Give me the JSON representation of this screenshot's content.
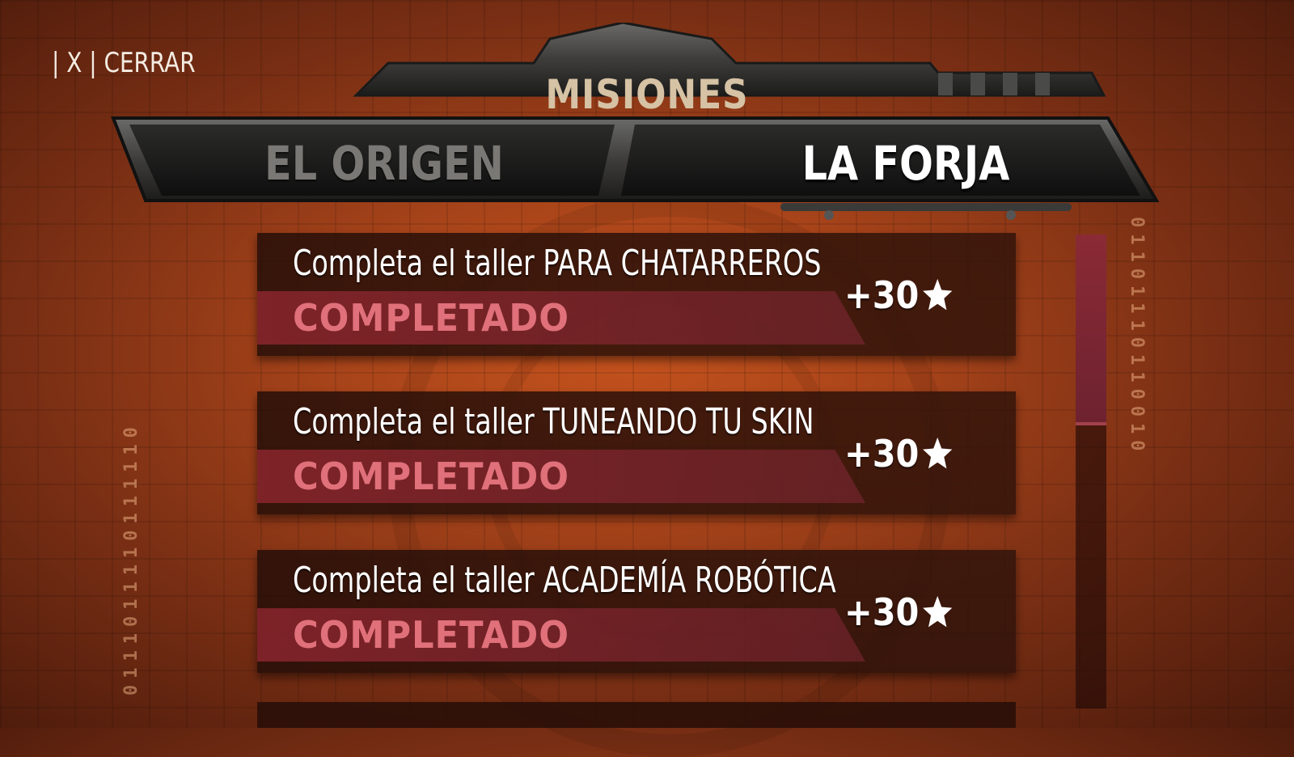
{
  "close_button": {
    "label": "| X | CERRAR"
  },
  "header": {
    "title": "MISIONES"
  },
  "tabs": [
    {
      "label": "EL ORIGEN",
      "active": false
    },
    {
      "label": "LA FORJA",
      "active": true
    }
  ],
  "missions": [
    {
      "title": "Completa el taller PARA CHATARREROS",
      "status": "COMPLETADO",
      "reward": "+30",
      "reward_icon": "star-icon"
    },
    {
      "title": "Completa el taller TUNEANDO TU SKIN",
      "status": "COMPLETADO",
      "reward": "+30",
      "reward_icon": "star-icon"
    },
    {
      "title": "Completa el taller ACADEMÍA ROBÓTICA",
      "status": "COMPLETADO",
      "reward": "+30",
      "reward_icon": "star-icon"
    }
  ],
  "scrollbar": {
    "position": 0.0
  },
  "background": {
    "binary_left": "0111011110111110",
    "binary_right": "01101110110010"
  },
  "colors": {
    "background": "#a8441a",
    "status_text": "#e0707a",
    "status_band": "#962832",
    "title_gold": "#d6c2a4",
    "scroll_thumb": "#8a2a35"
  }
}
